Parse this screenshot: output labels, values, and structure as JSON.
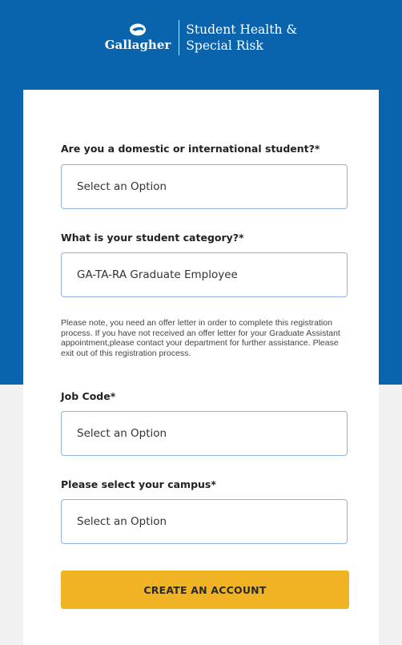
{
  "header": {
    "brand": "Gallagher",
    "tagline_line1": "Student Health &",
    "tagline_line2": "Special Risk"
  },
  "form": {
    "fields": [
      {
        "label": "Are you a domestic or international student?*",
        "value": "Select an Option"
      },
      {
        "label": "What is your student category?*",
        "value": "GA-TA-RA Graduate Employee"
      },
      {
        "label": "Job Code*",
        "value": "Select an Option"
      },
      {
        "label": "Please select your campus*",
        "value": "Select an Option"
      }
    ],
    "note": "Please note, you need an offer letter in order to complete this registration process. If you have not received an offer letter for your Graduate Assistant appointment,please contact your department for further assistance. Please exit out of this registration process.",
    "submit_label": "CREATE AN ACCOUNT"
  },
  "colors": {
    "brand_blue": "#0a63ad",
    "cta_yellow": "#f0b323",
    "field_border": "#8fb3d9"
  }
}
